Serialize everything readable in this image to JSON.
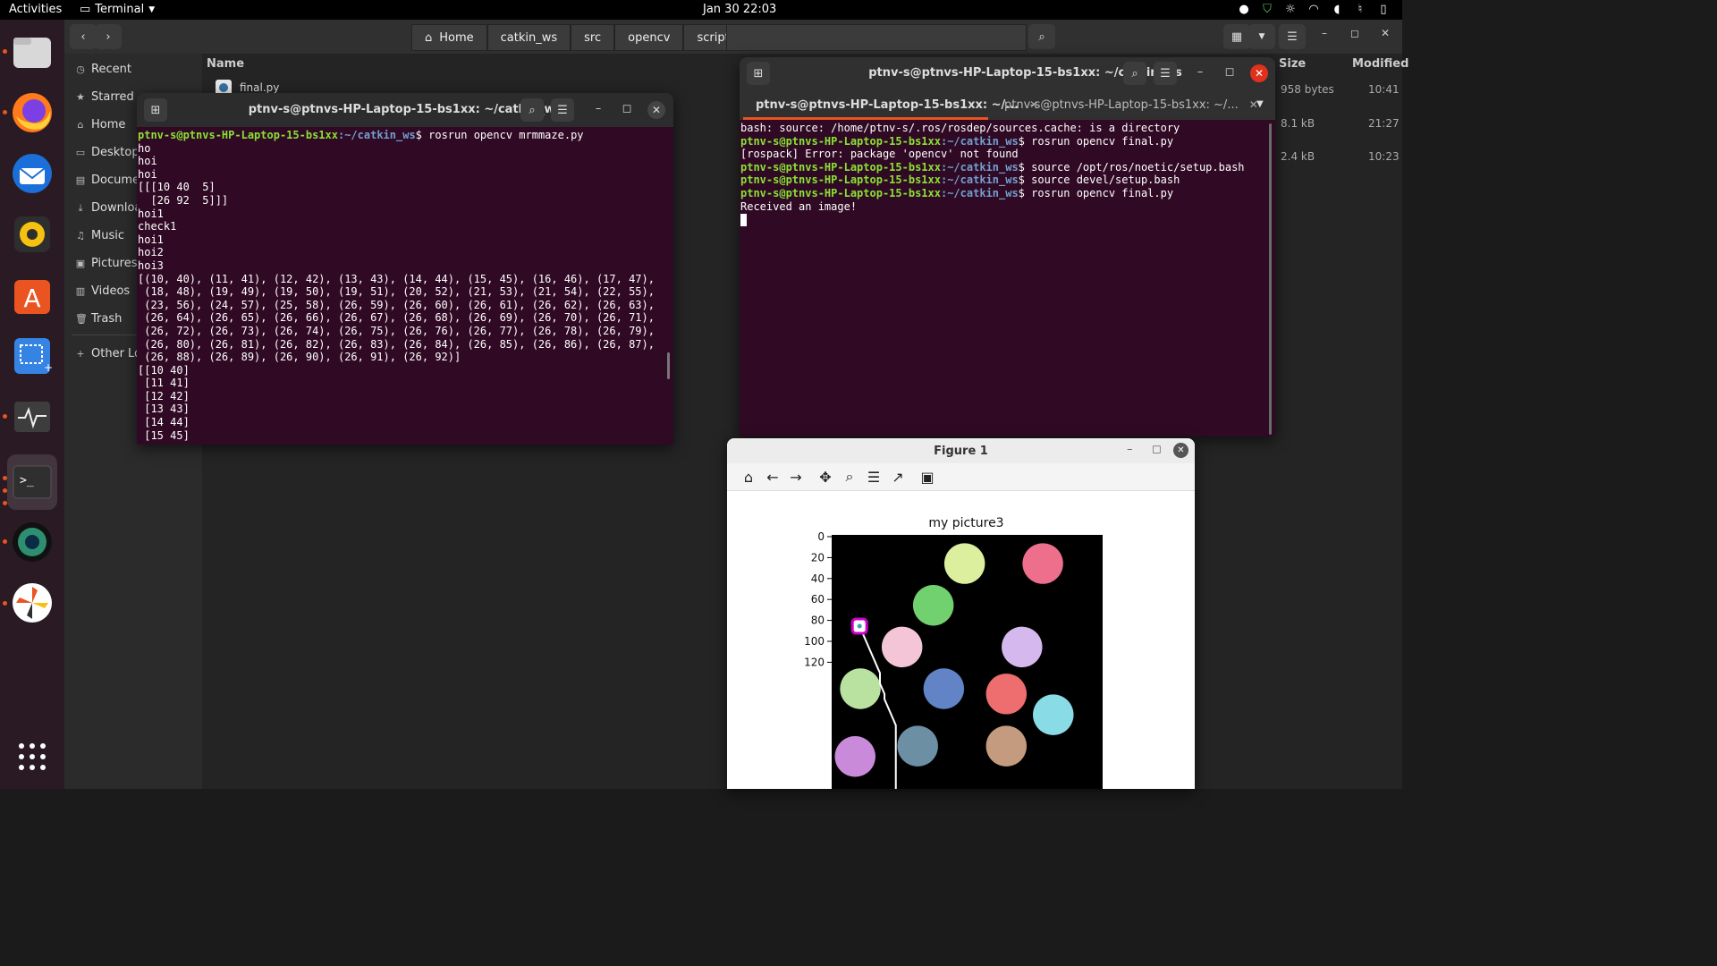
{
  "topbar": {
    "activities": "Activities",
    "app_name": "Terminal",
    "clock": "Jan 30  22:03",
    "tray_icons": [
      "notification-icon",
      "shield-icon",
      "brightness-icon",
      "wifi-icon",
      "volume-icon",
      "mic-icon",
      "battery-icon"
    ]
  },
  "dock": {
    "apps": [
      "files",
      "firefox",
      "thunderbird",
      "rhythmbox",
      "software",
      "screenshot",
      "system-monitor",
      "terminal",
      "camera",
      "pinwheel",
      "show-apps"
    ]
  },
  "files": {
    "breadcrumbs": [
      "Home",
      "catkin_ws",
      "src",
      "opencv",
      "scripts"
    ],
    "sidebar": [
      "Recent",
      "Starred",
      "Home",
      "Desktop",
      "Documents",
      "Downloads",
      "Music",
      "Pictures",
      "Videos",
      "Trash",
      "Other Locations"
    ],
    "columns": {
      "name": "Name",
      "size": "Size",
      "modified": "Modified"
    },
    "files": [
      {
        "name": "final.py",
        "size": "958 bytes",
        "modified": "10:41"
      },
      {
        "name": "",
        "size": "8.1 kB",
        "modified": "21:27"
      },
      {
        "name": "",
        "size": "2.4 kB",
        "modified": "10:23"
      }
    ]
  },
  "term1": {
    "title": "ptnv-s@ptnvs-HP-Laptop-15-bs1xx: ~/catkin_ws",
    "prompt_user": "ptnv-s@ptnvs-HP-Laptop-15-bs1xx",
    "prompt_path": ":~/catkin_ws",
    "command": "$ rosrun opencv mrmmaze.py",
    "output": "ho\nhoi\nhoi\n[[[10 40  5]\n  [26 92  5]]]\nhoi1\ncheck1\nhoi1\nhoi2\nhoi3\n[(10, 40), (11, 41), (12, 42), (13, 43), (14, 44), (15, 45), (16, 46), (17, 47),\n (18, 48), (19, 49), (19, 50), (19, 51), (20, 52), (21, 53), (21, 54), (22, 55),\n (23, 56), (24, 57), (25, 58), (26, 59), (26, 60), (26, 61), (26, 62), (26, 63),\n (26, 64), (26, 65), (26, 66), (26, 67), (26, 68), (26, 69), (26, 70), (26, 71),\n (26, 72), (26, 73), (26, 74), (26, 75), (26, 76), (26, 77), (26, 78), (26, 79),\n (26, 80), (26, 81), (26, 82), (26, 83), (26, 84), (26, 85), (26, 86), (26, 87),\n (26, 88), (26, 89), (26, 90), (26, 91), (26, 92)]\n[[10 40]\n [11 41]\n [12 42]\n [13 43]\n [14 44]\n [15 45]"
  },
  "term2": {
    "title": "ptnv-s@ptnvs-HP-Laptop-15-bs1xx: ~/catkin_ws",
    "tab1": "ptnv-s@ptnvs-HP-Laptop-15-bs1xx: ~/...",
    "tab2": "ptnv-s@ptnvs-HP-Laptop-15-bs1xx: ~/...",
    "line1": "bash: source: /home/ptnv-s/.ros/rosdep/sources.cache: is a directory",
    "prompt_user": "ptnv-s@ptnvs-HP-Laptop-15-bs1xx",
    "prompt_path": ":~/catkin_ws",
    "cmd1": "$ rosrun opencv final.py",
    "err1": "[rospack] Error: package 'opencv' not found",
    "cmd2": "$ source /opt/ros/noetic/setup.bash",
    "cmd3": "$ source devel/setup.bash",
    "cmd4": "$ rosrun opencv final.py",
    "out": "Received an image!"
  },
  "figure": {
    "window_title": "Figure 1",
    "tools": [
      "home-icon",
      "back-icon",
      "forward-icon",
      "pan-icon",
      "zoom-icon",
      "configure-icon",
      "edit-axis-icon",
      "save-icon"
    ],
    "plot_title": "my picture3",
    "yticks": [
      "0",
      "20",
      "40",
      "60",
      "80",
      "100",
      "120"
    ],
    "path_color": "#ffffff",
    "marker_color": "#cc00cc",
    "circles": [
      {
        "x": 25,
        "y": 5,
        "color": "#dcef9f"
      },
      {
        "x": 40,
        "y": 5,
        "color": "#ee6f8c"
      },
      {
        "x": 19,
        "y": 13,
        "color": "#71d16f"
      },
      {
        "x": 13,
        "y": 21,
        "color": "#f4c5d6"
      },
      {
        "x": 36,
        "y": 21,
        "color": "#d5b9ee"
      },
      {
        "x": 5,
        "y": 29,
        "color": "#b9e2a1"
      },
      {
        "x": 21,
        "y": 29,
        "color": "#6283c6"
      },
      {
        "x": 33,
        "y": 30,
        "color": "#ee6d6f"
      },
      {
        "x": 42,
        "y": 34,
        "color": "#89dce6"
      },
      {
        "x": 16,
        "y": 40,
        "color": "#6d8fa3"
      },
      {
        "x": 33,
        "y": 40,
        "color": "#c59b7f"
      },
      {
        "x": 4,
        "y": 42,
        "color": "#c98ad9"
      }
    ]
  }
}
